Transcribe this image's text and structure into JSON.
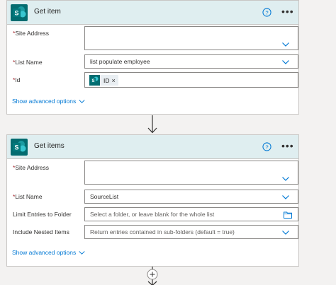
{
  "action1": {
    "title": "Get item",
    "fields": {
      "site_address": {
        "label": "Site Address",
        "required_mark": "*",
        "value": ""
      },
      "list_name": {
        "label": "List Name",
        "required_mark": "*",
        "value": "list populate employee"
      },
      "id": {
        "label": "Id",
        "required_mark": "*",
        "token": "ID",
        "token_remove": "×"
      }
    },
    "advanced": "Show advanced options"
  },
  "action2": {
    "title": "Get items",
    "fields": {
      "site_address": {
        "label": "Site Address",
        "required_mark": "*",
        "value": ""
      },
      "list_name": {
        "label": "List Name",
        "required_mark": "*",
        "value": "SourceList"
      },
      "limit_folder": {
        "label": "Limit Entries to Folder",
        "placeholder": "Select a folder, or leave blank for the whole list"
      },
      "nested": {
        "label": "Include Nested Items",
        "placeholder": "Return entries contained in sub-folders (default = true)"
      }
    },
    "advanced": "Show advanced options"
  },
  "icons": {
    "more": "•••",
    "help": "help-icon",
    "logo": "sharepoint-logo"
  },
  "colors": {
    "header_bg": "#dfeef0",
    "sharepoint": "#036c70",
    "link": "#0078d4",
    "required": "#a4262c"
  }
}
